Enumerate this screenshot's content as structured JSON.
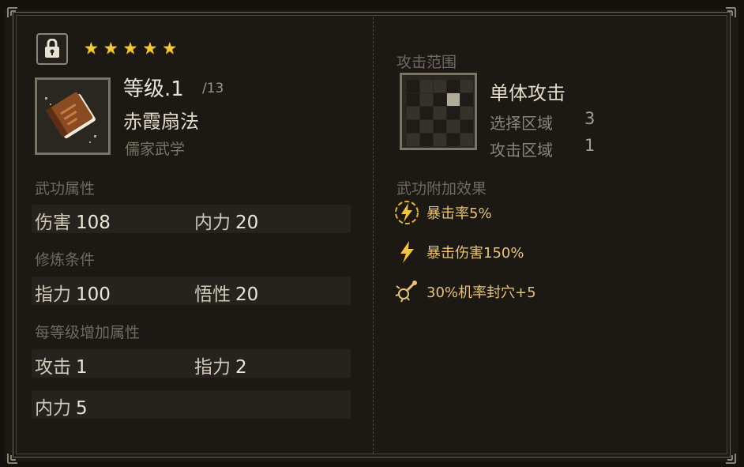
{
  "header": {
    "lock_icon": "lock-icon",
    "stars": [
      "★",
      "★",
      "★",
      "★",
      "★"
    ],
    "star_count": 5
  },
  "skill": {
    "icon": "book-icon",
    "level_text": "等级.1",
    "level_max": "/13",
    "name": "赤霞扇法",
    "school": "儒家武学"
  },
  "attributes": {
    "label": "武功属性",
    "items": [
      {
        "key": "伤害",
        "value": "108"
      },
      {
        "key": "内力",
        "value": "20"
      }
    ]
  },
  "requirements": {
    "label": "修炼条件",
    "items": [
      {
        "key": "指力",
        "value": "100"
      },
      {
        "key": "悟性",
        "value": "20"
      }
    ]
  },
  "per_level": {
    "label": "每等级增加属性",
    "items": [
      {
        "key": "攻击",
        "value": "1"
      },
      {
        "key": "指力",
        "value": "2"
      },
      {
        "key": "内力",
        "value": "5"
      }
    ]
  },
  "attack_range": {
    "label": "攻击范围",
    "type": "单体攻击",
    "select_label": "选择区域",
    "select_value": "3",
    "attack_label": "攻击区域",
    "attack_value": "1"
  },
  "effects": {
    "label": "武功附加效果",
    "items": [
      {
        "icon": "lightning-circle-icon",
        "text": "暴击率5%"
      },
      {
        "icon": "lightning-icon",
        "text": "暴击伤害150%"
      },
      {
        "icon": "acupoint-seal-icon",
        "text": "30%机率封穴+5"
      }
    ]
  },
  "colors": {
    "star": "#f3c93a",
    "effect_text": "#e6c27a",
    "panel": "#1c1915"
  }
}
